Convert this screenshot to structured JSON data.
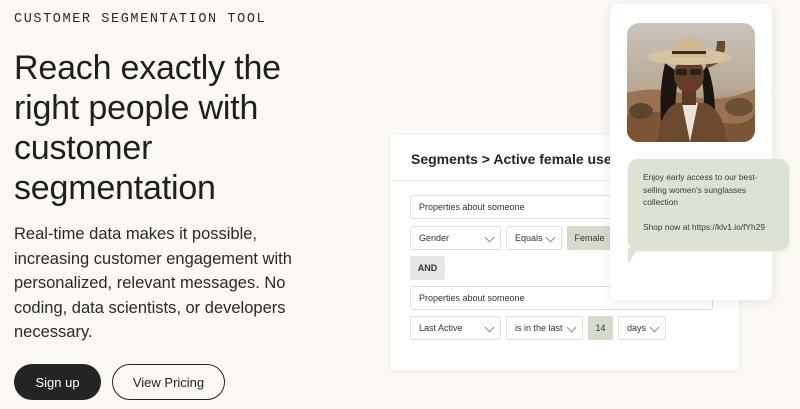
{
  "hero": {
    "eyebrow": "CUSTOMER SEGMENTATION TOOL",
    "headline": "Reach exactly the right people with customer segmentation",
    "body": "Real-time data makes it possible, increasing customer engagement with personalized, relevant messages. No coding, data scientists, or developers necessary.",
    "signup_label": "Sign up",
    "pricing_label": "View Pricing"
  },
  "segment_card": {
    "title": "Segments > Active female users",
    "row1_property": "Properties about someone",
    "row2_field": "Gender",
    "row2_operator": "Equals",
    "row2_value": "Female",
    "and_label": "AND",
    "row3_property": "Properties about someone",
    "row4_field": "Last Active",
    "row4_operator": "is in the last",
    "row4_value": "14",
    "row4_unit": "days"
  },
  "message": {
    "line1": "Enjoy early access to our best-selling women's sunglasses collection",
    "line2": "Shop now at https://klv1.io/fYh29"
  },
  "colors": {
    "background": "#fbf7f2",
    "dark_button": "#232426",
    "tag_green": "#d6dccd",
    "bubble_green": "#dce3d4"
  }
}
